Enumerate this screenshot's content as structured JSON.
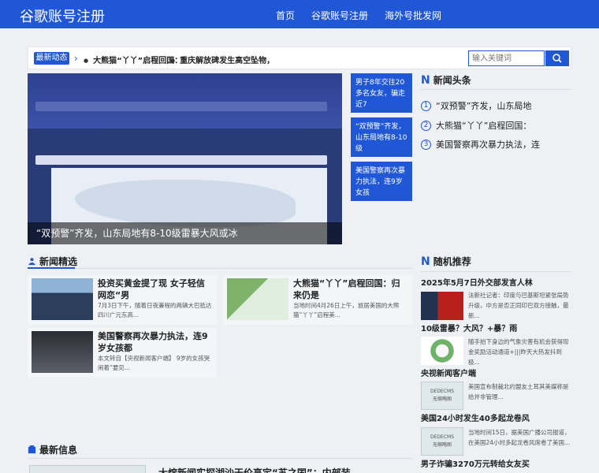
{
  "header": {
    "site_title": "谷歌账号注册",
    "nav": [
      "首页",
      "谷歌账号注册",
      "海外号批发网"
    ]
  },
  "ticker": {
    "label": "最新动态",
    "items": [
      "大熊猫“丫丫”启程回国：",
      "重庆解放碑发生高空坠物，"
    ]
  },
  "search": {
    "placeholder": "输入关键词"
  },
  "hero": {
    "caption": "“双预警”齐发，山东局地有8-10级雷暴大风或冰"
  },
  "mini_cards": [
    "男子8年交往20多名女友，骗走近7",
    "“双预警”齐发，山东局地有8-10级",
    "美国警察再次暴力执法，连9岁女孩"
  ],
  "headlines": {
    "title": "新闻头条",
    "items": [
      {
        "num": "1",
        "text": "“双预警”齐发，山东局地"
      },
      {
        "num": "2",
        "text": "大熊猫“丫丫”启程回国："
      },
      {
        "num": "3",
        "text": "美国警察再次暴力执法，连"
      }
    ]
  },
  "picks": {
    "title": "新闻精选",
    "cards": [
      {
        "title": "投资买黄金提了现 女子轻信网恋“男",
        "desc": "7月3日下午，随着日夜兼程的两辆大巴抵达四川广元东高..."
      },
      {
        "title": "大熊猫“丫丫”启程回国：归来仍是",
        "desc": "当地时间4月26日上午，旅居美国的大熊猫“丫丫”启程美..."
      },
      {
        "title": "美国警察再次暴力执法，连9岁女孩都",
        "desc": "本文转自【央视新闻客户端】 9岁的女孩哭闹着“要见..."
      }
    ]
  },
  "latest": {
    "title": "最新信息",
    "first_title": "大熔新闻实探湖沙天价高定“苏之国”：内部装"
  },
  "random": {
    "title": "随机推荐",
    "items": [
      {
        "head": "2025年5月7日外交部发言人林",
        "desc": "法新社记者：印度与巴基斯坦紧张局势升级，中方是否正同印巴双方接触，最新..."
      },
      {
        "head": "10级雷暴？大风？+暴？雨",
        "desc": "随手拍下身边的气象灾害有机会获得现金奖励活动通道+|||昨天大热发抖到极..."
      },
      {
        "head": "央视新闻客户端",
        "desc": "美国宣布制裁北约盟友土耳其美媒称是给并非管理..."
      },
      {
        "head": "美国24小时发生40多起龙卷风",
        "desc": "当地时间15日，据美国广播公司报道，在美国24小时多起龙卷风席卷了美国..."
      },
      {
        "head": "男子诈骗3270万元转给女友买",
        "desc": ""
      }
    ],
    "dede_badge": "DEDECMS\n无缩略图"
  }
}
